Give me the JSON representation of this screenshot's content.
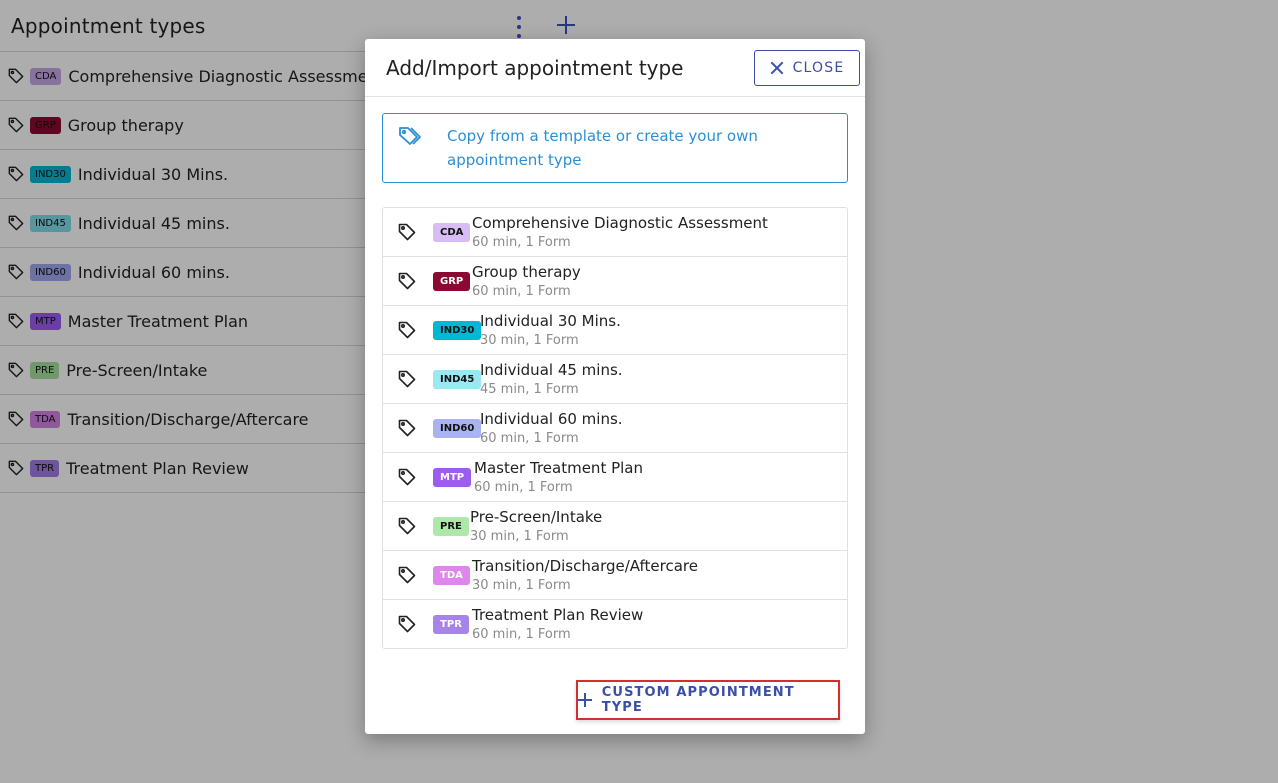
{
  "background": {
    "title": "Appointment types",
    "items": [
      {
        "badge": "CDA",
        "badge_color": "#c8a8e6",
        "name": "Comprehensive Diagnostic Assessment"
      },
      {
        "badge": "GRP",
        "badge_color": "#8b0a33",
        "name": "Group therapy"
      },
      {
        "badge": "IND30",
        "badge_color": "#00b8d4",
        "name": "Individual 30 Mins."
      },
      {
        "badge": "IND45",
        "badge_color": "#80deea",
        "name": "Individual 45 mins."
      },
      {
        "badge": "IND60",
        "badge_color": "#9fa8ee",
        "name": "Individual 60 mins."
      },
      {
        "badge": "MTP",
        "badge_color": "#9c5cf0",
        "name": "Master Treatment Plan"
      },
      {
        "badge": "PRE",
        "badge_color": "#a5e1a0",
        "name": "Pre-Screen/Intake"
      },
      {
        "badge": "TDA",
        "badge_color": "#d680e6",
        "name": "Transition/Discharge/Aftercare"
      },
      {
        "badge": "TPR",
        "badge_color": "#a07ee8",
        "name": "Treatment Plan Review"
      }
    ]
  },
  "modal": {
    "title": "Add/Import appointment type",
    "close_label": "CLOSE",
    "info_text": "Copy from a template or create your own appointment type",
    "templates": [
      {
        "badge": "CDA",
        "badge_color": "#d7bdf3",
        "name": "Comprehensive Diagnostic Assessment",
        "sub": "60 min, 1 Form"
      },
      {
        "badge": "GRP",
        "badge_color": "#8b0a33",
        "badge_text_color": "#ffffff",
        "name": "Group therapy",
        "sub": "60 min, 1 Form"
      },
      {
        "badge": "IND30",
        "badge_color": "#00b8d4",
        "name": "Individual 30 Mins.",
        "sub": "30 min, 1 Form"
      },
      {
        "badge": "IND45",
        "badge_color": "#9be8f2",
        "name": "Individual 45 mins.",
        "sub": "45 min, 1 Form"
      },
      {
        "badge": "IND60",
        "badge_color": "#aab3f2",
        "name": "Individual 60 mins.",
        "sub": "60 min, 1 Form"
      },
      {
        "badge": "MTP",
        "badge_color": "#9c5cf0",
        "badge_text_color": "#ffffff",
        "name": "Master Treatment Plan",
        "sub": "60 min, 1 Form"
      },
      {
        "badge": "PRE",
        "badge_color": "#aee8a8",
        "name": "Pre-Screen/Intake",
        "sub": "30 min, 1 Form"
      },
      {
        "badge": "TDA",
        "badge_color": "#de86ec",
        "badge_text_color": "#ffffff",
        "name": "Transition/Discharge/Aftercare",
        "sub": "30 min, 1 Form"
      },
      {
        "badge": "TPR",
        "badge_color": "#a784ea",
        "badge_text_color": "#ffffff",
        "name": "Treatment Plan Review",
        "sub": "60 min, 1 Form"
      }
    ],
    "custom_button_label": "CUSTOM APPOINTMENT TYPE"
  },
  "colors": {
    "accent": "#3a4fa8",
    "info": "#2b8fd6",
    "highlight_border": "#d32f2f"
  }
}
